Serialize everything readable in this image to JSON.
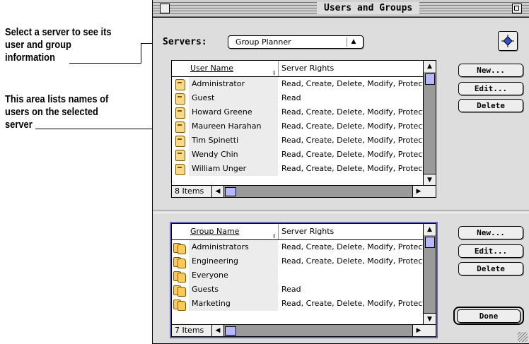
{
  "callouts": [
    {
      "lines": [
        "Select a server to see its",
        "user and group",
        "information"
      ]
    },
    {
      "lines": [
        "This area lists names of",
        "users on the selected",
        "server"
      ]
    }
  ],
  "window": {
    "title": "Users and Groups"
  },
  "servers": {
    "label": "Servers:",
    "selected": "Group Planner"
  },
  "users": {
    "col_name": "User Name",
    "col_rights": "Server Rights",
    "count": "8 Items",
    "rows": [
      {
        "name": "Administrator",
        "rights": "Read, Create, Delete, Modify, Protect"
      },
      {
        "name": "Guest",
        "rights": "Read"
      },
      {
        "name": "Howard Greene",
        "rights": "Read, Create, Delete, Modify, Protect"
      },
      {
        "name": "Maureen Harahan",
        "rights": "Read, Create, Delete, Modify, Protect"
      },
      {
        "name": "Tim Spinetti",
        "rights": "Read, Create, Delete, Modify, Protect"
      },
      {
        "name": "Wendy Chin",
        "rights": "Read, Create, Delete, Modify, Protect"
      },
      {
        "name": "William Unger",
        "rights": "Read, Create, Delete, Modify, Protect"
      }
    ]
  },
  "groups": {
    "col_name": "Group Name",
    "col_rights": "Server Rights",
    "count": "7 Items",
    "rows": [
      {
        "name": "Administrators",
        "rights": "Read, Create, Delete, Modify, Protect"
      },
      {
        "name": "Engineering",
        "rights": "Read, Create, Delete, Modify, Protect"
      },
      {
        "name": "Everyone",
        "rights": ""
      },
      {
        "name": "Guests",
        "rights": "Read"
      },
      {
        "name": "Marketing",
        "rights": "Read, Create, Delete, Modify, Protect"
      }
    ]
  },
  "buttons": {
    "user_new": "New...",
    "user_edit": "Edit...",
    "user_delete": "Delete",
    "group_new": "New...",
    "group_edit": "Edit...",
    "group_delete": "Delete",
    "done": "Done"
  },
  "icons": {
    "user_icon": "user-face-icon",
    "group_icon": "group-faces-icon",
    "server_button_icon": "network-icon"
  },
  "colors": {
    "window_bg": "#dddddd",
    "scroll_thumb": "#b8b8ff",
    "focus_ring": "#6a6ab0"
  }
}
